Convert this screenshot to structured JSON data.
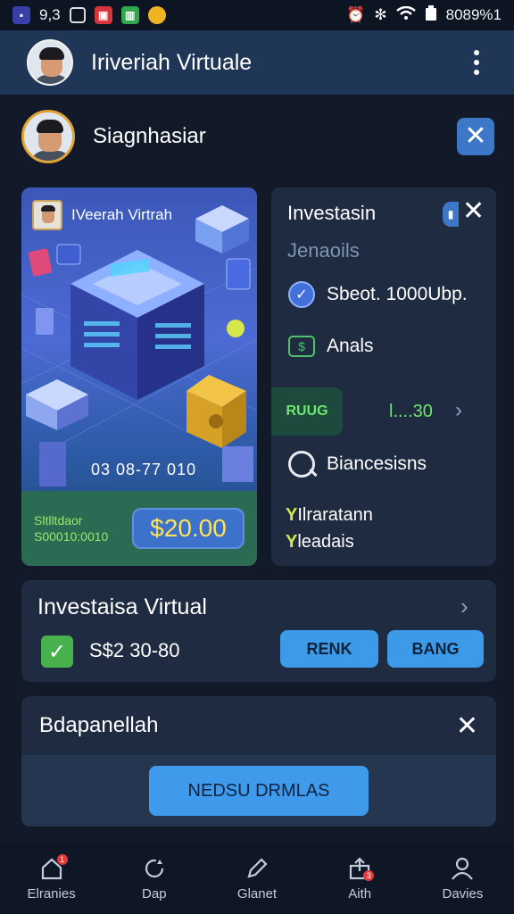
{
  "status_bar": {
    "time": "9,3",
    "right_text": "8089%1",
    "icons": [
      "notification-icon",
      "screenshot-icon",
      "red-app-icon",
      "green-app-icon",
      "yellow-app-icon",
      "alarm-icon",
      "signal-icon",
      "wifi-icon",
      "battery-icon"
    ]
  },
  "app_bar": {
    "title": "Iriveriah Virtuale"
  },
  "profile": {
    "name": "Siagnhasiar"
  },
  "hero": {
    "title": "IVeerah Virtrah",
    "date": "03 08-77 010",
    "footer_line1": "Sltlltdaor",
    "footer_line2": "S00010:0010",
    "price": "$20.00"
  },
  "panel": {
    "title": "Investasin",
    "subtitle": "Jenaoils",
    "row1": "Sbeot. 1000Ubp.",
    "row2": "Anals",
    "green_pill": "RUUG",
    "range": "l....30",
    "row3": "Biancesisns",
    "line1": "Ilraratann",
    "line2": "leadais"
  },
  "investasi_card": {
    "title": "Investaisa Virtual",
    "amount": "S$2 30-80",
    "btn1": "RENK",
    "btn2": "BANG"
  },
  "bottom_card": {
    "title": "Bdapanellah",
    "cta": "NEDSU DRMLAS"
  },
  "bottom_nav": [
    {
      "label": "Elranies",
      "icon": "home-icon",
      "badge": "1"
    },
    {
      "label": "Dap",
      "icon": "refresh-icon",
      "badge": ""
    },
    {
      "label": "Glanet",
      "icon": "edit-icon",
      "badge": ""
    },
    {
      "label": "Aith",
      "icon": "share-icon",
      "badge": "3"
    },
    {
      "label": "Davies",
      "icon": "profile-icon",
      "badge": ""
    }
  ],
  "colors": {
    "background": "#121a2a",
    "app_bar": "#1f3656",
    "card": "#1e2b40",
    "accent_blue": "#3d78c8",
    "green": "#6ee56e",
    "price_text": "#ffe15a"
  }
}
